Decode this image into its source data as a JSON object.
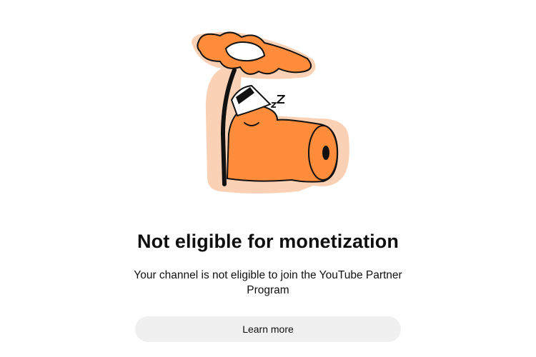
{
  "dialog": {
    "illustration_icon": "sleeping-creature-under-umbrella-illustration",
    "title": "Not eligible for monetization",
    "message": "Your channel is not eligible to join the YouTube Partner Program",
    "learn_more_label": "Learn more"
  },
  "colors": {
    "illustration_orange": "#ff8c3a",
    "illustration_halo": "#fbd1b5",
    "button_background": "#f0f0f0",
    "text": "#0f0f0f"
  }
}
